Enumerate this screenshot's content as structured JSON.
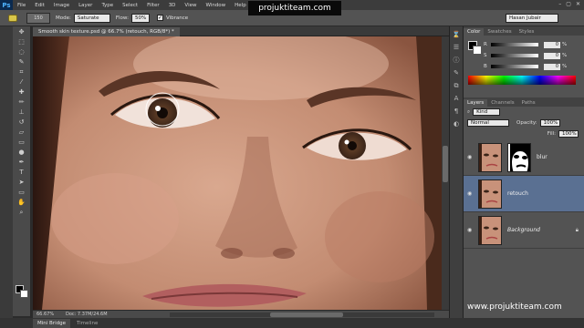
{
  "app": {
    "logo": "Ps",
    "menu": [
      "File",
      "Edit",
      "Image",
      "Layer",
      "Type",
      "Select",
      "Filter",
      "3D",
      "View",
      "Window",
      "Help"
    ],
    "watermark_banner": "projuktiteam.com",
    "window_controls": [
      "–",
      "▢",
      "✕"
    ]
  },
  "options": {
    "brush_size": "150",
    "mode_label": "Mode:",
    "mode_value": "Saturate",
    "flow_label": "Flow:",
    "flow_value": "50%",
    "vibrance_label": "Vibrance",
    "vibrance_checked": "✓",
    "workspace": "Hasan Jubair"
  },
  "document": {
    "tab_title": "Smooth skin texture.psd @ 66.7% (retouch, RGB/8*) *",
    "zoom": "66.67%",
    "doc_size": "Doc: 7.37M/24.6M"
  },
  "bottom_tabs": [
    "Mini Bridge",
    "Timeline"
  ],
  "color_panel": {
    "tabs": [
      "Color",
      "Swatches",
      "Styles"
    ],
    "rows": [
      {
        "label": "R",
        "value": "0",
        "unit": "%"
      },
      {
        "label": "S",
        "value": "0",
        "unit": "%"
      },
      {
        "label": "B",
        "value": "0",
        "unit": "%"
      }
    ],
    "foreground": "#000000",
    "background": "#ffffff"
  },
  "layers_panel": {
    "tabs": [
      "Layers",
      "Channels",
      "Paths"
    ],
    "kind_label": "Kind",
    "blend_mode": "Normal",
    "opacity_label": "Opacity:",
    "opacity_value": "100%",
    "fill_label": "Fill:",
    "fill_value": "100%",
    "layers": [
      {
        "name": "blur",
        "has_mask": true,
        "selected": false
      },
      {
        "name": "retouch",
        "has_mask": false,
        "selected": true
      },
      {
        "name": "Background",
        "has_mask": false,
        "selected": false,
        "locked": true
      }
    ]
  },
  "footer_caption": "www.projuktiteam.com",
  "colors": {
    "accent_selected_layer": "#5a7092",
    "menubar": "#3c3c3c",
    "options_bar": "#535353"
  }
}
